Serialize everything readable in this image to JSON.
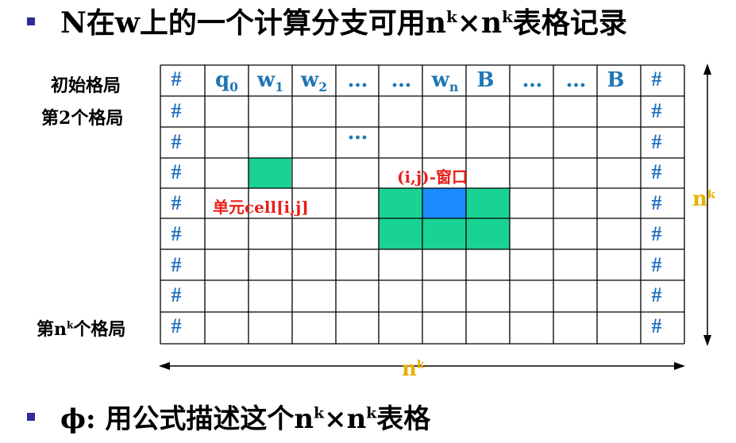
{
  "title": {
    "prefix": "N在w上的一个计算分支可用n",
    "sup1": "k",
    "mid": "×n",
    "sup2": "k",
    "suffix": "表格记录"
  },
  "bottom": {
    "prefix": "ϕ: 用公式描述这个n",
    "sup1": "k",
    "mid": "×n",
    "sup2": "k",
    "suffix": "表格"
  },
  "row_labels": {
    "first": "初始格局",
    "second_prefix": "第",
    "second_num": "2",
    "second_suffix": "个格局",
    "last_prefix": "第",
    "last_n": "n",
    "last_sup": "k",
    "last_suffix": "个格局"
  },
  "first_row": {
    "hash_left": "#",
    "q": "q",
    "q_sub": "0",
    "w": "w",
    "w1_sub": "1",
    "w2_sub": "2",
    "dots": "…",
    "wn_sub": "n",
    "B": "B",
    "hash_right": "#"
  },
  "hash": "#",
  "middle_dots": "…",
  "cell_label": "单元cell[i,j]",
  "window_label": "(i,j)-窗口",
  "dimension_label": {
    "n": "n",
    "sup": "k"
  },
  "colors": {
    "teal": "#1ad392",
    "blue": "#1a8cff",
    "red": "#e8201a",
    "orange": "#e8b000",
    "text_blue": "#1f77b4"
  }
}
